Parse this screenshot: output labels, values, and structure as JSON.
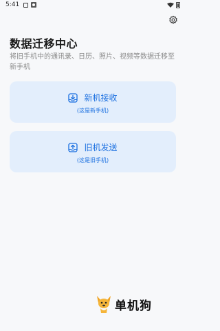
{
  "status_bar": {
    "time": "5:41",
    "icons": [
      "notification-box-icon",
      "alert-app-icon",
      "wifi-icon",
      "battery-icon"
    ]
  },
  "header": {
    "title": "数据迁移中心",
    "subtitle": "将旧手机中的通讯录、日历、照片、视频等数据迁移至新手机",
    "settings_icon": "gear-icon"
  },
  "actions": {
    "receive": {
      "label": "新机接收",
      "hint": "(这是新手机)",
      "icon": "tray-download-icon"
    },
    "send": {
      "label": "旧机发送",
      "hint": "(这是旧手机)",
      "icon": "tray-upload-icon"
    }
  },
  "watermark": {
    "text": "单机狗"
  },
  "colors": {
    "accent": "#1a6fe0",
    "card_bg": "#e3eefc",
    "page_bg": "#f7f8fa"
  }
}
